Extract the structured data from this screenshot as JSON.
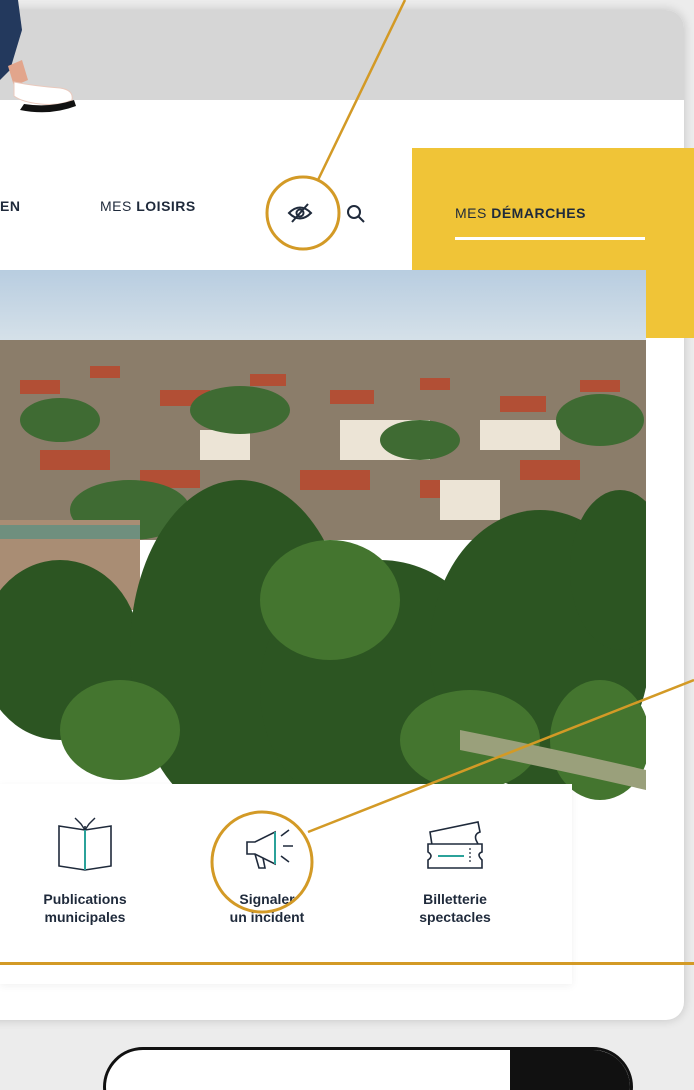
{
  "nav": {
    "item_en": "EN",
    "loisirs_prefix": "MES ",
    "loisirs_bold": "LOISIRS",
    "demarches_prefix": "MES ",
    "demarches_bold": "DÉMARCHES"
  },
  "tiles": [
    {
      "icon": "open-book-icon",
      "line1": "Publications",
      "line2": "municipales"
    },
    {
      "icon": "megaphone-icon",
      "line1": "Signaler",
      "line2": "un incident"
    },
    {
      "icon": "tickets-icon",
      "line1": "Billetterie",
      "line2": "spectacles"
    }
  ],
  "colors": {
    "accent_yellow": "#f0c437",
    "callout_gold": "#d39a26",
    "text_dark": "#1f2a3b"
  }
}
